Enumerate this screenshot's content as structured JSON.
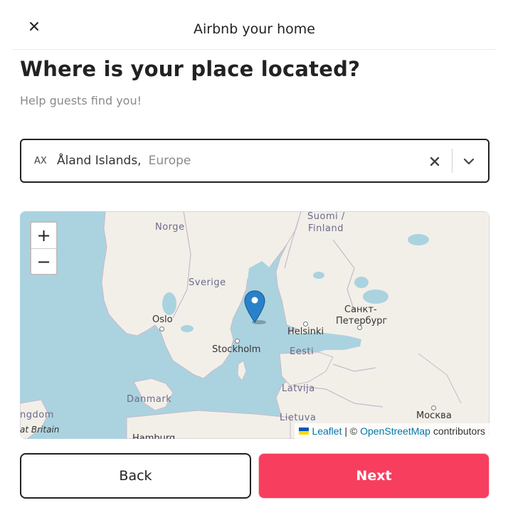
{
  "header": {
    "title": "Airbnb your home"
  },
  "page": {
    "title": "Where is your place located?",
    "subtitle": "Help guests find you!"
  },
  "location": {
    "code": "AX",
    "country": "Åland Islands,",
    "region": "Europe"
  },
  "map": {
    "zoom_in": "+",
    "zoom_out": "−",
    "labels": {
      "norge": "Norge",
      "sverige": "Sverige",
      "suomi": "Suomi /",
      "finland": "Finland",
      "oslo": "Oslo",
      "stockholm": "Stockholm",
      "helsinki": "Helsinki",
      "spb1": "Санкт-",
      "spb2": "Петербург",
      "eesti": "Eesti",
      "latvija": "Latvija",
      "danmark": "Danmark",
      "lietuva": "Lietuva",
      "moskva": "Москва",
      "kingdom": "ngdom",
      "britain": "at Britain",
      "hamburg": "Hamburg"
    },
    "attribution": {
      "leaflet": "Leaflet",
      "separator": " | © ",
      "osm": "OpenStreetMap",
      "contributors": " contributors"
    },
    "colors": {
      "water": "#aad3df",
      "land": "#f2efe9",
      "pin": "#2a81cb"
    }
  },
  "footer": {
    "back_label": "Back",
    "next_label": "Next"
  },
  "colors": {
    "accent": "#f73e5f",
    "text": "#222222",
    "muted": "#8a8a8a"
  }
}
